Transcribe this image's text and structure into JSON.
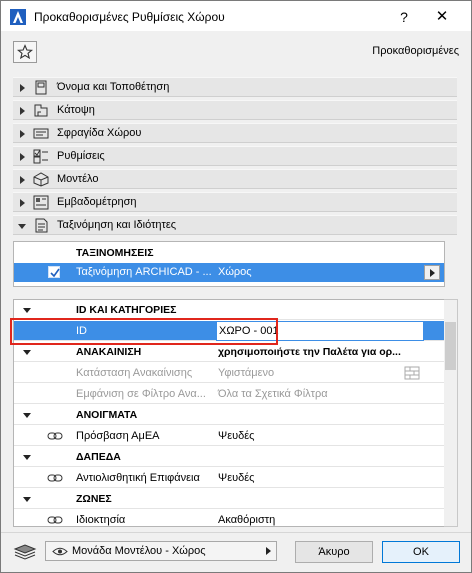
{
  "window": {
    "title": "Προκαθορισμένες Ρυθμίσεις Χώρου",
    "help_glyph": "?",
    "close_glyph": "✕"
  },
  "toolbar": {
    "favorites_icon": "star-icon",
    "preset_label": "Προκαθορισμένες"
  },
  "panels": [
    {
      "label": "Όνομα και Τοποθέτηση",
      "icon": "name-position-icon",
      "expanded": false
    },
    {
      "label": "Κάτοψη",
      "icon": "floor-plan-icon",
      "expanded": false
    },
    {
      "label": "Σφραγίδα Χώρου",
      "icon": "zone-stamp-icon",
      "expanded": false
    },
    {
      "label": "Ρυθμίσεις",
      "icon": "settings-icon",
      "expanded": false
    },
    {
      "label": "Μοντέλο",
      "icon": "model-icon",
      "expanded": false
    },
    {
      "label": "Εμβαδομέτρηση",
      "icon": "area-calc-icon",
      "expanded": false
    },
    {
      "label": "Ταξινόμηση και Ιδιότητες",
      "icon": "classification-icon",
      "expanded": true
    }
  ],
  "classifications": {
    "header": "ΤΑΞΙΝΟΜΗΣΕΙΣ",
    "row": {
      "system": "Ταξινόμηση ARCHICAD - ...",
      "value": "Χώρος",
      "checked": true
    }
  },
  "properties": {
    "groups": [
      {
        "name": "ID ΚΑΙ ΚΑΤΗΓΟΡΙΕΣ"
      },
      {
        "name": "ΑΝΑΚΑΙΝΙΣΗ",
        "value": "χρησιμοποιήστε την Παλέτα για ορ..."
      },
      {
        "name": "ΑΝΟΙΓΜΑΤΑ"
      },
      {
        "name": "ΔΑΠΕΔΑ"
      },
      {
        "name": "ΖΩΝΕΣ"
      }
    ],
    "id_row": {
      "label": "ID",
      "value": "ΧΩΡΟ - 001"
    },
    "renovation_rows": [
      {
        "label": "Κατάσταση Ανακαίνισης",
        "value": "Υφιστάμενο"
      },
      {
        "label": "Εμφάνιση σε Φίλτρο Ανα...",
        "value": "Όλα τα Σχετικά Φίλτρα"
      }
    ],
    "openings_row": {
      "label": "Πρόσβαση ΑμΕΑ",
      "value": "Ψευδές"
    },
    "floors_row": {
      "label": "Αντιολισθητική Επιφάνεια",
      "value": "Ψευδές"
    },
    "zones_row": {
      "label": "Ιδιοκτησία",
      "value": "Ακαθόριστη"
    }
  },
  "footer": {
    "view_dropdown": "Μονάδα Μοντέλου - Χώρος",
    "cancel_label": "Άκυρο",
    "ok_label": "OK"
  }
}
